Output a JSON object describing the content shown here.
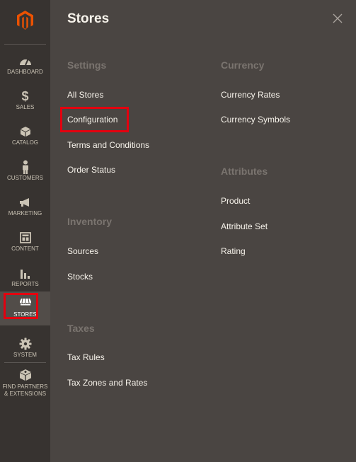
{
  "sidebar": {
    "items": [
      {
        "label": "DASHBOARD",
        "icon": "dashboard-icon"
      },
      {
        "label": "SALES",
        "icon": "dollar-icon"
      },
      {
        "label": "CATALOG",
        "icon": "box-icon"
      },
      {
        "label": "CUSTOMERS",
        "icon": "person-icon"
      },
      {
        "label": "MARKETING",
        "icon": "megaphone-icon"
      },
      {
        "label": "CONTENT",
        "icon": "layout-icon"
      },
      {
        "label": "REPORTS",
        "icon": "bar-chart-icon"
      },
      {
        "label": "STORES",
        "icon": "storefront-icon",
        "active": true
      },
      {
        "label": "SYSTEM",
        "icon": "gear-icon"
      },
      {
        "label": "FIND PARTNERS",
        "label2": "& EXTENSIONS",
        "icon": "puzzle-box-icon"
      }
    ]
  },
  "panel": {
    "title": "Stores",
    "settings": {
      "title": "Settings",
      "links": [
        "All Stores",
        "Configuration",
        "Terms and Conditions",
        "Order Status"
      ]
    },
    "inventory": {
      "title": "Inventory",
      "links": [
        "Sources",
        "Stocks"
      ]
    },
    "taxes": {
      "title": "Taxes",
      "links": [
        "Tax Rules",
        "Tax Zones and Rates"
      ]
    },
    "currency": {
      "title": "Currency",
      "links": [
        "Currency Rates",
        "Currency Symbols"
      ]
    },
    "attributes": {
      "title": "Attributes",
      "links": [
        "Product",
        "Attribute Set",
        "Rating"
      ]
    }
  },
  "colors": {
    "sidebar_bg": "#373330",
    "panel_bg": "#4a4542",
    "accent_orange": "#eb5202",
    "highlight_red": "#e3000f"
  }
}
